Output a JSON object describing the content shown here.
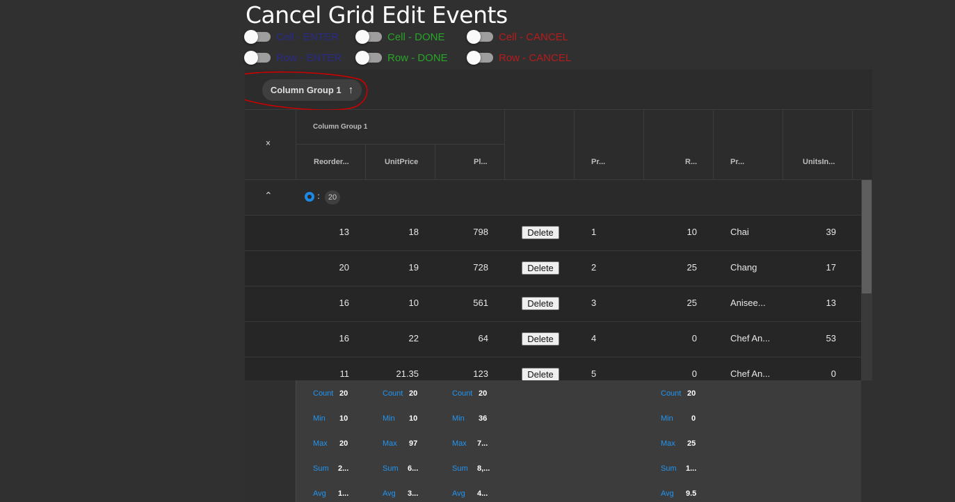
{
  "title": "Cancel Grid Edit Events",
  "toggles": [
    {
      "label": "Cell - ENTER",
      "color": "#2a2a8a"
    },
    {
      "label": "Cell - DONE",
      "color": "#27a527"
    },
    {
      "label": "Cell - CANCEL",
      "color": "#b71c1c"
    },
    {
      "label": "Row - ENTER",
      "color": "#2a2a8a"
    },
    {
      "label": "Row - DONE",
      "color": "#27a527"
    },
    {
      "label": "Row - CANCEL",
      "color": "#b71c1c"
    }
  ],
  "group_area": {
    "chip_label": "Column Group 1",
    "chip_icon": "arrow-up-icon"
  },
  "header": {
    "group_label": "Column Group 1",
    "columns": [
      "Reorder...",
      "UnitPrice",
      "Pl...",
      "",
      "Pr...",
      "R...",
      "Pr...",
      "UnitsIn..."
    ]
  },
  "group_row": {
    "count": "20",
    "separator": ":"
  },
  "rows": [
    {
      "reorder": "13",
      "unitprice": "18",
      "pl": "798",
      "action": "Delete",
      "pr": "1",
      "r": "10",
      "name": "Chai",
      "units": "39"
    },
    {
      "reorder": "20",
      "unitprice": "19",
      "pl": "728",
      "action": "Delete",
      "pr": "2",
      "r": "25",
      "name": "Chang",
      "units": "17"
    },
    {
      "reorder": "16",
      "unitprice": "10",
      "pl": "561",
      "action": "Delete",
      "pr": "3",
      "r": "25",
      "name": "Anisee...",
      "units": "13"
    },
    {
      "reorder": "16",
      "unitprice": "22",
      "pl": "64",
      "action": "Delete",
      "pr": "4",
      "r": "0",
      "name": "Chef An...",
      "units": "53"
    },
    {
      "reorder": "11",
      "unitprice": "21.35",
      "pl": "123",
      "action": "Delete",
      "pr": "5",
      "r": "0",
      "name": "Chef An...",
      "units": "0"
    }
  ],
  "summaries": {
    "labels": [
      "Count",
      "Min",
      "Max",
      "Sum",
      "Avg"
    ],
    "columns": [
      {
        "values": [
          "20",
          "10",
          "20",
          "2...",
          "1..."
        ]
      },
      {
        "values": [
          "20",
          "10",
          "97",
          "6...",
          "3..."
        ]
      },
      {
        "values": [
          "20",
          "36",
          "7...",
          "8,...",
          "4..."
        ]
      },
      {
        "values": [
          "20",
          "0",
          "25",
          "1...",
          "9.5"
        ]
      }
    ]
  }
}
